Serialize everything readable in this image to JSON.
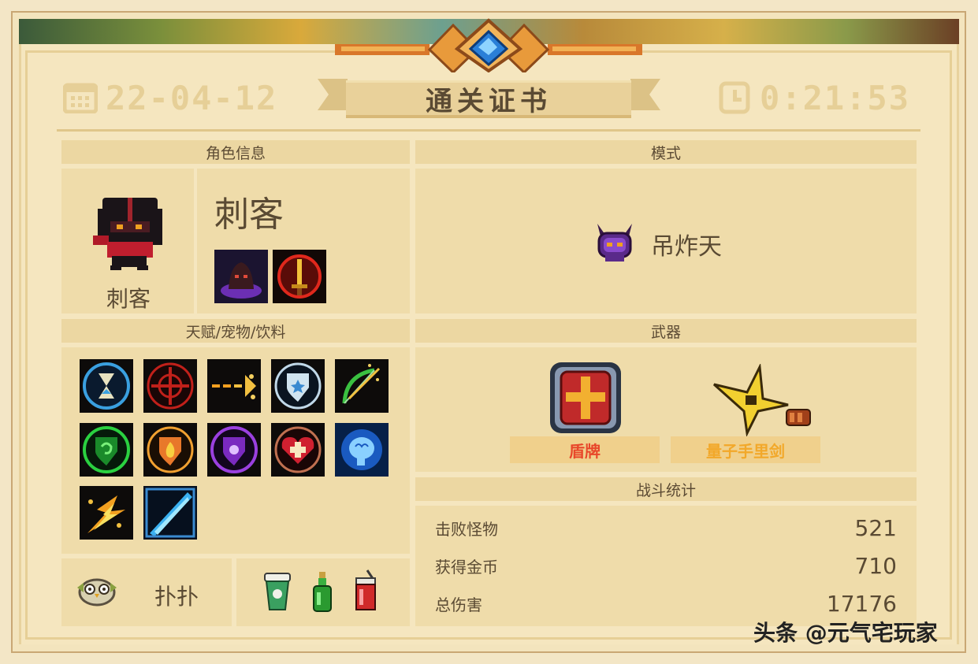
{
  "header": {
    "date": "22-04-12",
    "title": "通关证书",
    "time": "0:21:53"
  },
  "character": {
    "section": "角色信息",
    "name": "刺客",
    "label": "刺客",
    "skills": [
      "shadow-hood-icon",
      "golden-sword-icon"
    ]
  },
  "mode": {
    "section": "模式",
    "name": "吊炸天",
    "icon": "purple-demon-icon"
  },
  "talents": {
    "section": "天赋/宠物/饮料",
    "items": [
      "hourglass-icon",
      "crosshair-icon",
      "dash-arrow-icon",
      "shield-star-icon",
      "bow-icon",
      "green-shield-icon",
      "fire-shield-icon",
      "purple-shield-icon",
      "heart-plus-icon",
      "brain-icon",
      "explosion-icon",
      "blue-blade-icon"
    ],
    "pet_name": "扑扑",
    "drinks": [
      "coffee-cup-icon",
      "green-bottle-icon",
      "red-soda-icon"
    ]
  },
  "weapons": {
    "section": "武器",
    "items": [
      {
        "name": "盾牌",
        "color": "#e8472a"
      },
      {
        "name": "量子手里剑",
        "color": "#f2a82a"
      }
    ]
  },
  "stats": {
    "section": "战斗统计",
    "rows": [
      {
        "label": "击败怪物",
        "value": "521"
      },
      {
        "label": "获得金币",
        "value": "710"
      },
      {
        "label": "总伤害",
        "value": "17176"
      }
    ]
  },
  "watermark": "头条 @元气宅玩家"
}
